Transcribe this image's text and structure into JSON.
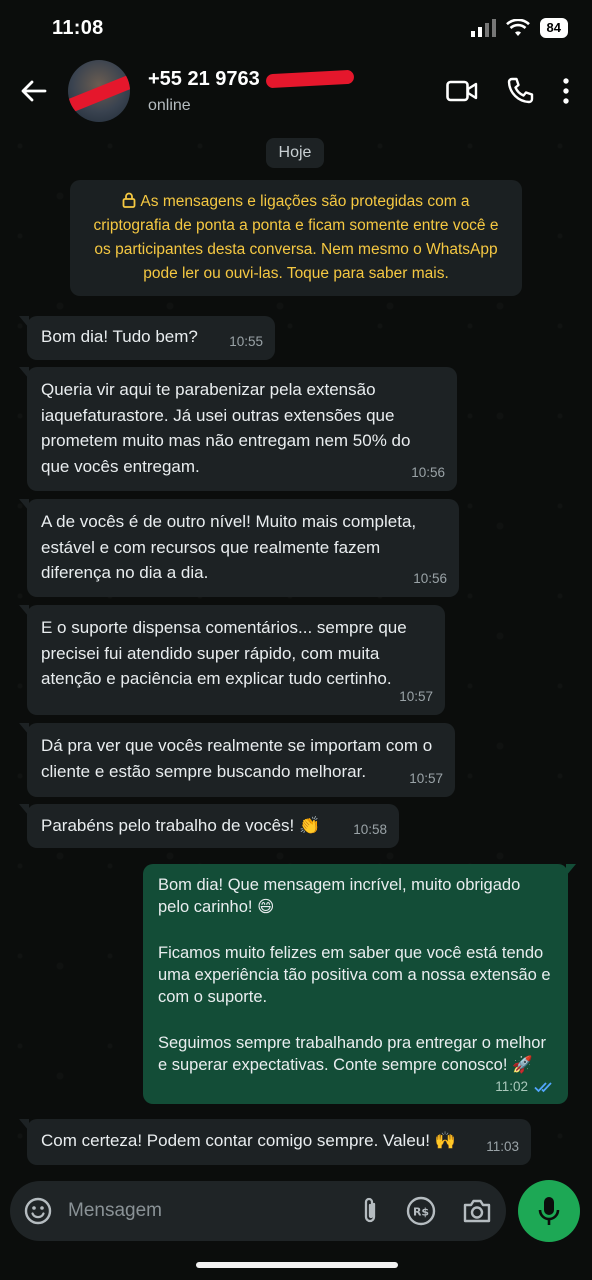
{
  "status_bar": {
    "time": "11:08",
    "battery": "84",
    "icons": [
      "signal-icon",
      "wifi-icon",
      "battery-icon"
    ]
  },
  "header": {
    "contact_name": "+55 21 9763",
    "status": "online",
    "icons": [
      "back-arrow-icon",
      "video-call-icon",
      "phone-icon",
      "more-vert-icon"
    ]
  },
  "chat": {
    "date_label": "Hoje",
    "encryption_notice": "As mensagens e ligações são protegidas com a criptografia de ponta a ponta e ficam somente entre você e os participantes desta conversa. Nem mesmo o WhatsApp pode ler ou ouvi-las. Toque para saber mais.",
    "messages": [
      {
        "direction": "in",
        "text": "Bom dia! Tudo bem?",
        "time": "10:55"
      },
      {
        "direction": "in",
        "text": "Queria vir aqui te parabenizar pela extensão iaquefaturastore. Já usei outras extensões que prometem muito mas não entregam nem 50% do que vocês entregam.",
        "time": "10:56"
      },
      {
        "direction": "in",
        "text": "A de vocês é de outro nível! Muito mais completa, estável e com recursos que realmente fazem diferença no dia a dia.",
        "time": "10:56"
      },
      {
        "direction": "in",
        "text": "E o suporte dispensa comentários... sempre que precisei fui atendido super rápido, com muita atenção e paciência em explicar tudo certinho.",
        "time": "10:57"
      },
      {
        "direction": "in",
        "text": "Dá pra ver que vocês realmente se importam com o cliente e estão sempre buscando melhorar.",
        "time": "10:57"
      },
      {
        "direction": "in",
        "text": "Parabéns pelo trabalho de vocês! 👏",
        "time": "10:58"
      },
      {
        "direction": "out",
        "paragraphs": [
          "Bom dia! Que mensagem incrível, muito obrigado pelo carinho! 😄",
          "Ficamos muito felizes em saber que você está tendo uma experiência tão positiva com a nossa extensão e com o suporte.",
          "Seguimos sempre trabalhando pra entregar o melhor e superar expectativas. Conte sempre conosco! 🚀"
        ],
        "time": "11:02",
        "read_receipt": "double-check-icon"
      },
      {
        "direction": "in",
        "text": "Com certeza! Podem contar comigo sempre. Valeu! 🙌",
        "time": "11:03"
      }
    ]
  },
  "composer": {
    "placeholder": "Mensagem",
    "icons": [
      "emoji-icon",
      "attach-icon",
      "payment-icon",
      "camera-icon",
      "mic-icon"
    ]
  },
  "colors": {
    "background": "#0b0d0c",
    "incoming_bubble": "#1d2224",
    "outgoing_bubble": "#134d37",
    "notice_text": "#f5c842",
    "mic_button": "#1da855"
  }
}
